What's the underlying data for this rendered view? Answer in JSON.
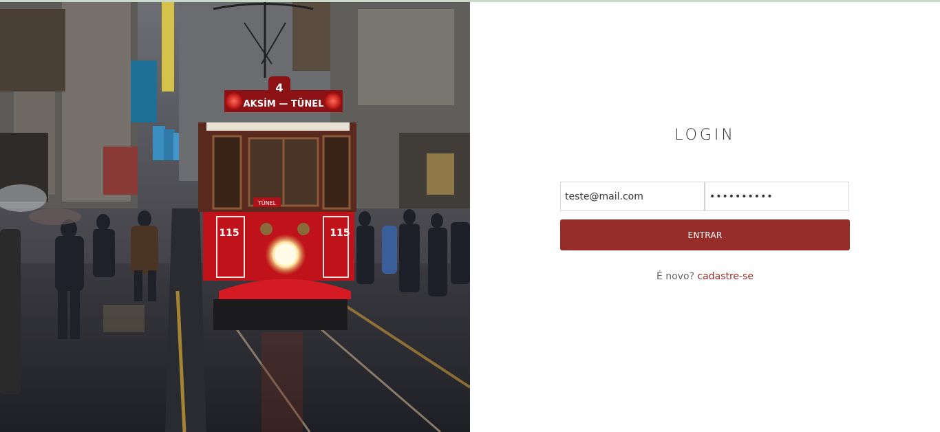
{
  "login": {
    "title": "LOGIN",
    "email_value": "teste@mail.com",
    "password_value": "••••••••••",
    "submit_label": "ENTRAR",
    "signup_prompt": "É novo?",
    "signup_link": "cadastre-se"
  },
  "photo": {
    "tram_number": "4",
    "tram_route": "AKSİM — TÜNEL",
    "tram_plate": "TÜNEL",
    "tram_id": "115"
  },
  "colors": {
    "accent": "#962d2b",
    "border": "#d6d6d6",
    "title": "#333333",
    "muted_text": "#666666"
  }
}
